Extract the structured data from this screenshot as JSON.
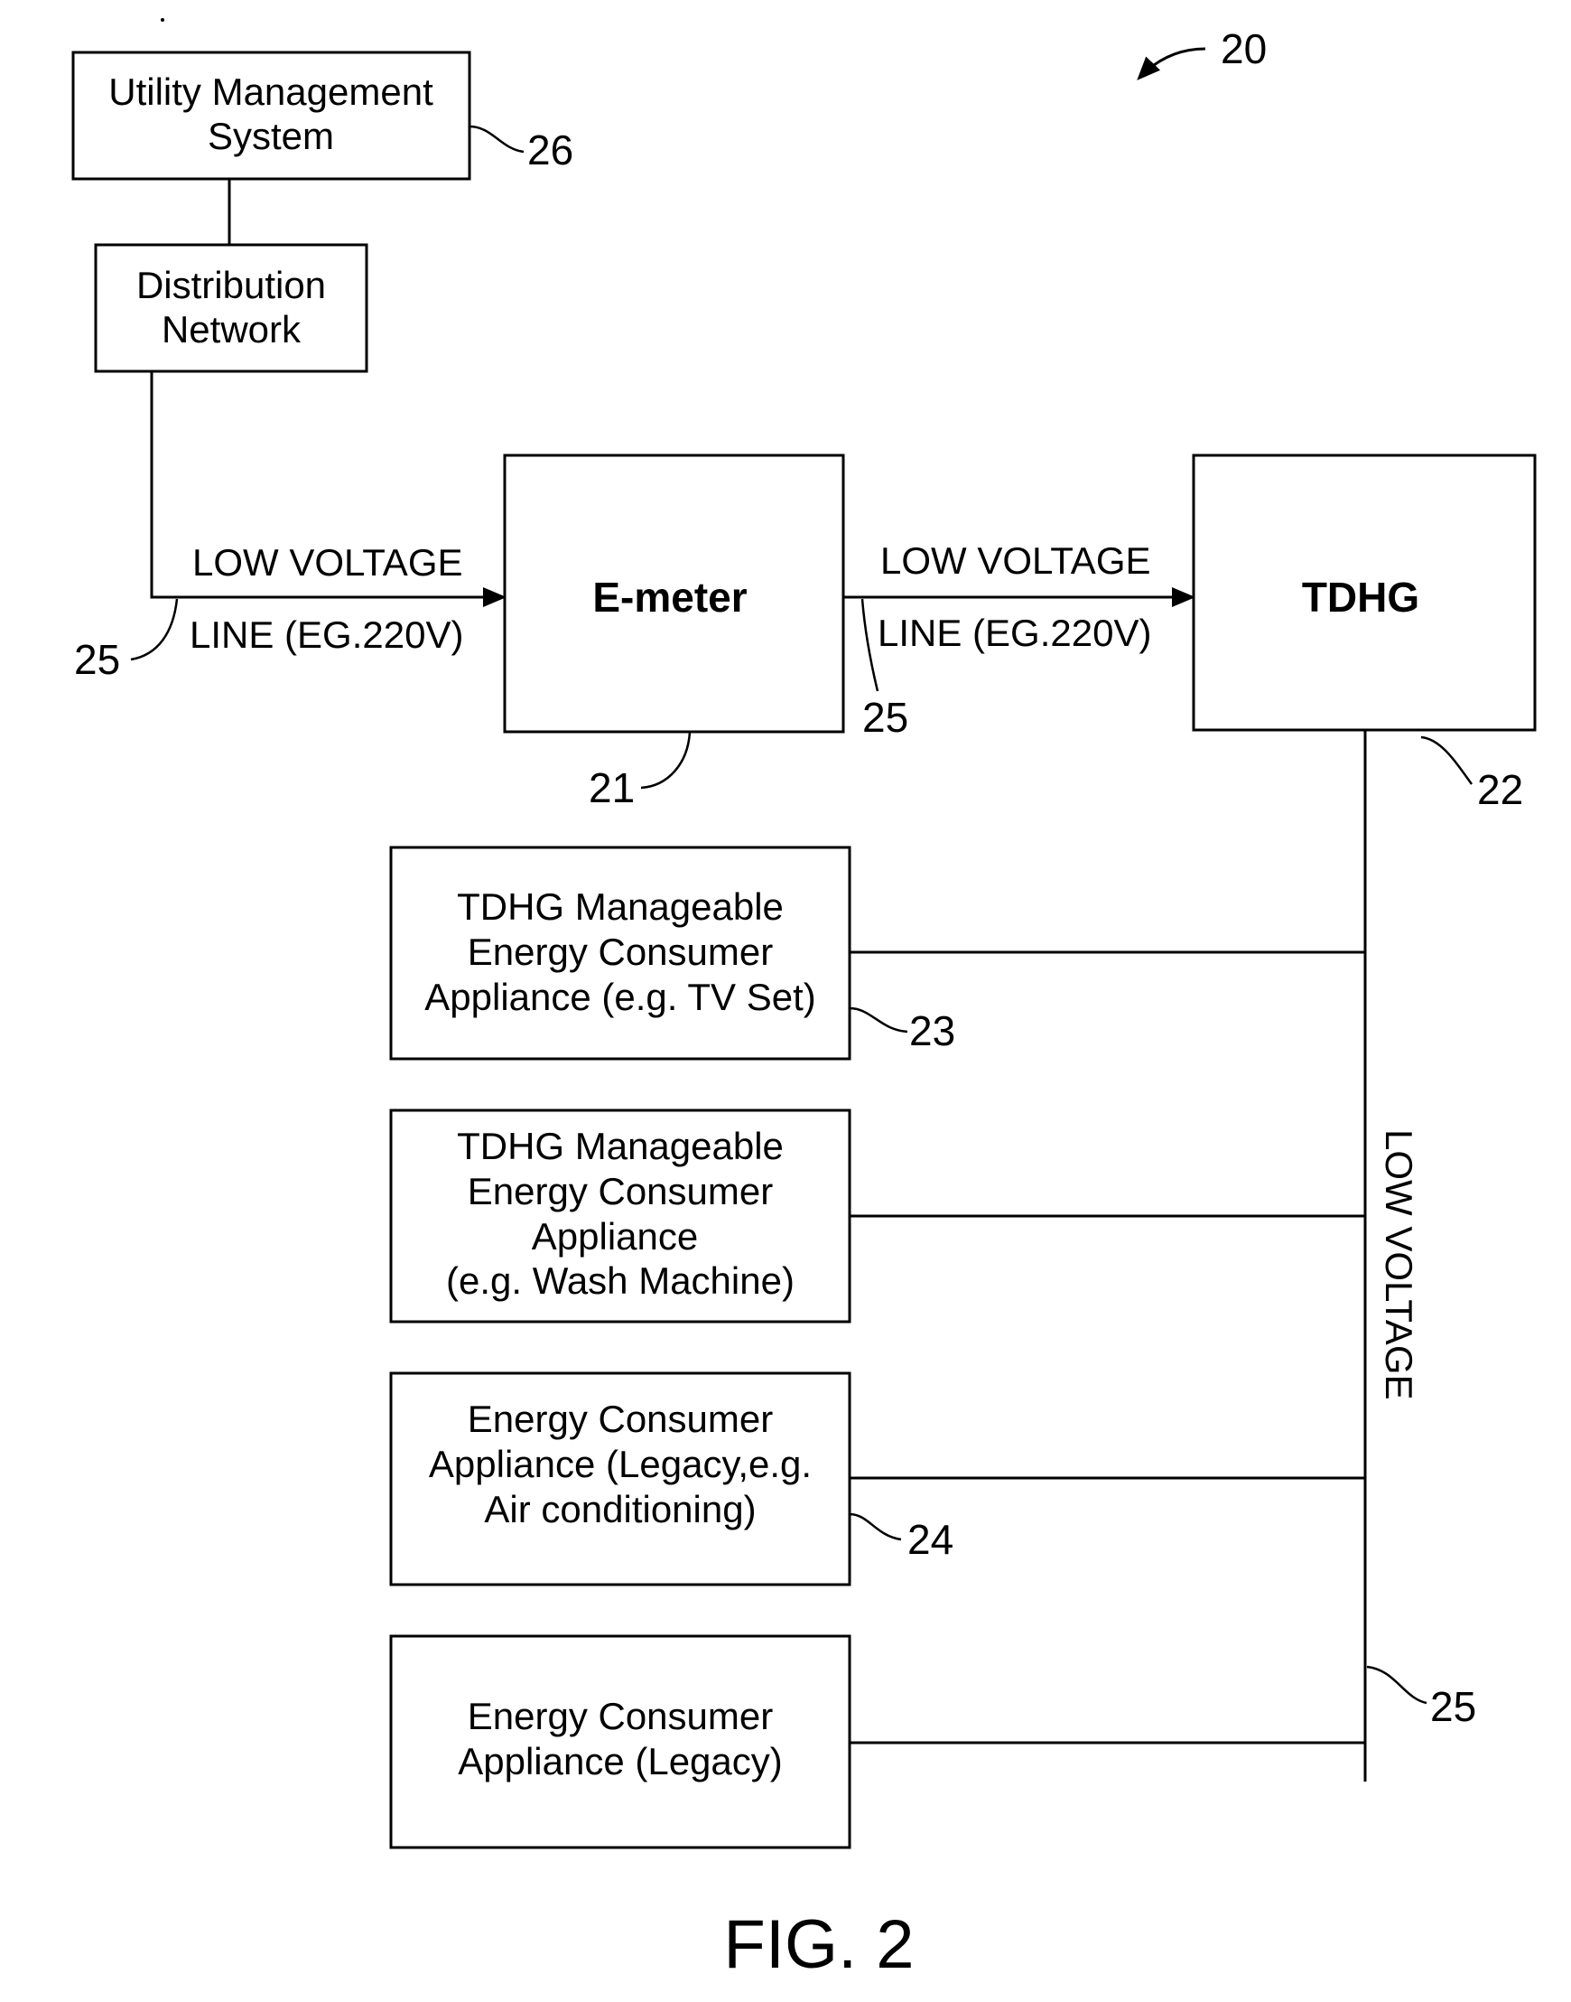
{
  "figure": {
    "label": "FIG. 2",
    "system_ref": "20"
  },
  "nodes": {
    "utility": {
      "lines": [
        "Utility Management",
        "System"
      ],
      "ref": "26"
    },
    "distribution": {
      "lines": [
        "Distribution",
        "Network"
      ]
    },
    "emeter": {
      "label": "E-meter",
      "ref": "21"
    },
    "tdhg": {
      "label": "TDHG",
      "ref": "22"
    },
    "appliances": [
      {
        "lines": [
          "TDHG Manageable",
          "Energy Consumer",
          "Appliance (e.g. TV Set)"
        ],
        "ref": "23"
      },
      {
        "lines": [
          "TDHG Manageable",
          "Energy Consumer",
          "Appliance",
          "(e.g. Wash Machine)"
        ],
        "ref": ""
      },
      {
        "lines": [
          "Energy Consumer",
          "Appliance (Legacy,e.g.",
          "Air conditioning)"
        ],
        "ref": "24"
      },
      {
        "lines": [
          "Energy Consumer",
          "Appliance (Legacy)"
        ],
        "ref": ""
      }
    ]
  },
  "links": {
    "line1": {
      "top": "LOW VOLTAGE",
      "bottom": "LINE (EG.220V)",
      "ref": "25"
    },
    "line2": {
      "top": "LOW VOLTAGE",
      "bottom": "LINE (EG.220V)",
      "ref": "25"
    },
    "bus": {
      "label": "LOW VOLTAGE",
      "ref": "25"
    }
  }
}
